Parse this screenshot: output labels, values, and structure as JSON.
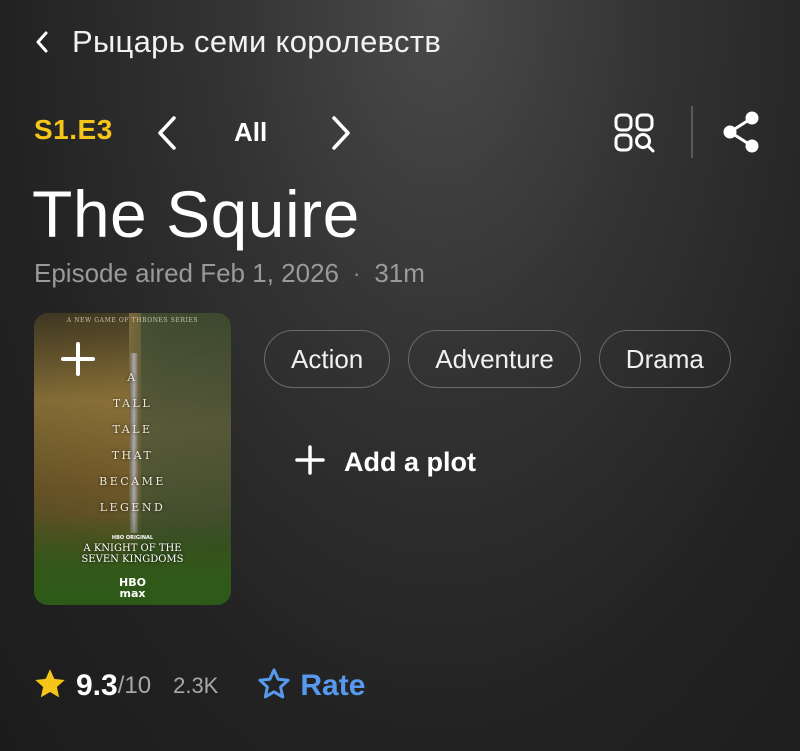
{
  "header": {
    "title": "Рыцарь семи королевств"
  },
  "episode_nav": {
    "code": "S1.E3",
    "filter_label": "All"
  },
  "episode": {
    "title": "The Squire",
    "aired": "Episode aired Feb 1, 2026",
    "separator": "·",
    "runtime": "31m"
  },
  "poster": {
    "header_text": "A NEW GAME OF THRONES SERIES",
    "tagline_lines": [
      "A",
      "TALL",
      "TALE",
      "THAT",
      "BECAME",
      "LEGEND"
    ],
    "hbo_small": "HBO ORIGINAL",
    "show_title_line1": "A KNIGHT OF THE",
    "show_title_line2": "SEVEN KINGDOMS",
    "network_line1": "HBO",
    "network_line2": "max"
  },
  "genres": [
    "Action",
    "Adventure",
    "Drama"
  ],
  "add_plot_label": "Add a plot",
  "rating": {
    "value": "9.3",
    "scale": "/10",
    "count": "2.3K",
    "rate_label": "Rate"
  },
  "colors": {
    "accent_yellow": "#f5c518",
    "rate_blue": "#5799ef"
  },
  "icons": {
    "back": "chevron-left-icon",
    "prev": "chevron-left-icon",
    "next": "chevron-right-icon",
    "episodes_grid": "grid-search-icon",
    "share": "share-icon",
    "watchlist": "plus-icon",
    "add_plot": "plus-icon",
    "rating_star": "star-filled-icon",
    "rate_star": "star-outline-icon"
  }
}
